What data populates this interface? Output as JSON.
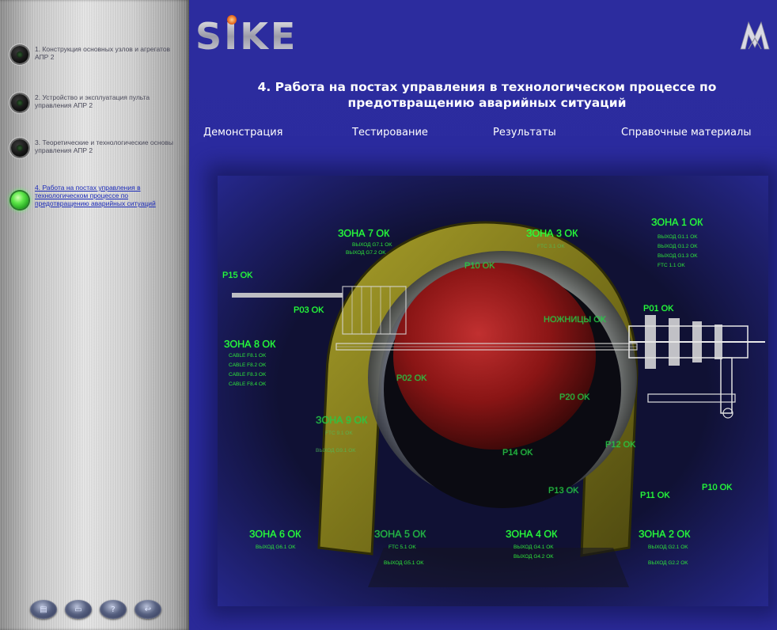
{
  "sidebar": {
    "items": [
      {
        "label": "1. Конструкция основных узлов и агрегатов АПР 2",
        "active": false
      },
      {
        "label": "2. Устройство и эксплуатация пульта управления АПР 2",
        "active": false
      },
      {
        "label": "3. Теоретические и технологические основы управления АПР 2",
        "active": false
      },
      {
        "label": "4. Работа на постах управления в технологическом процессе по предотвращению аварийных ситуаций",
        "active": true
      }
    ],
    "bottom_buttons": [
      {
        "icon": "book-icon",
        "glyph": "▤"
      },
      {
        "icon": "monitor-icon",
        "glyph": "▭"
      },
      {
        "icon": "help-icon",
        "glyph": "?"
      },
      {
        "icon": "exit-icon",
        "glyph": "↩"
      }
    ]
  },
  "header": {
    "logo_text": "SIKE",
    "title_line1": "4. Работа на постах управления в технологическом процессе по",
    "title_line2": "предотвращению аварийных ситуаций"
  },
  "menu": {
    "demo": "Демонстрация",
    "testing": "Тестирование",
    "results": "Результаты",
    "reference": "Справочные материалы"
  },
  "scheme": {
    "zones": {
      "z7": {
        "label": "ЗОНА 7 ОК",
        "sub": [
          "ВЫХОД G7.1 OK",
          "ВЫХОД G7.2 OK"
        ]
      },
      "z3": {
        "label": "ЗОНА 3 ОК",
        "sub": [
          "FTC 3.1 OK"
        ]
      },
      "z1": {
        "label": "ЗОНА 1 ОК",
        "sub": [
          "ВЫХОД G1.1 OK",
          "ВЫХОД G1.2 OK",
          "ВЫХОД G1.3 OK",
          "FTC 1.1 OK"
        ]
      },
      "z8": {
        "label": "ЗОНА 8 ОК",
        "sub": [
          "CABLE F8.1 OK",
          "CABLE F8.2 OK",
          "CABLE F8.3 OK",
          "CABLE F8.4 OK"
        ]
      },
      "z9": {
        "label": "ЗОНА 9 ОК",
        "sub": [
          "FTC 9.1 OK",
          "ВЫХОД G9.1 OK"
        ]
      },
      "z6": {
        "label": "ЗОНА 6 ОК",
        "sub": [
          "ВЫХОД G6.1 OK"
        ]
      },
      "z5": {
        "label": "ЗОНА 5 ОК",
        "sub": [
          "FTC 5.1 OK",
          "ВЫХОД G5.1 OK"
        ]
      },
      "z4": {
        "label": "ЗОНА 4 ОК",
        "sub": [
          "ВЫХОД G4.1 OK",
          "ВЫХОД G4.2 OK"
        ]
      },
      "z2": {
        "label": "ЗОНА 2 ОК",
        "sub": [
          "ВЫХОД G2.1 OK",
          "ВЫХОД G2.2 OK"
        ]
      }
    },
    "posts": {
      "p15": "P15 OK",
      "p03": "P03 OK",
      "p10_top": "P10 OK",
      "scissors": "НОЖНИЦЫ OK",
      "p01": "P01 OK",
      "p02": "P02 OK",
      "p20": "P20 OK",
      "p14": "P14 OK",
      "p12": "P12 OK",
      "p13": "P13 OK",
      "p11": "P11 OK",
      "p10": "P10 OK"
    },
    "colors": {
      "ok_green": "#2fff3c",
      "button_red": "#9c1717",
      "guard_yellow": "#9a9418",
      "background": "#2a2aa0"
    }
  }
}
